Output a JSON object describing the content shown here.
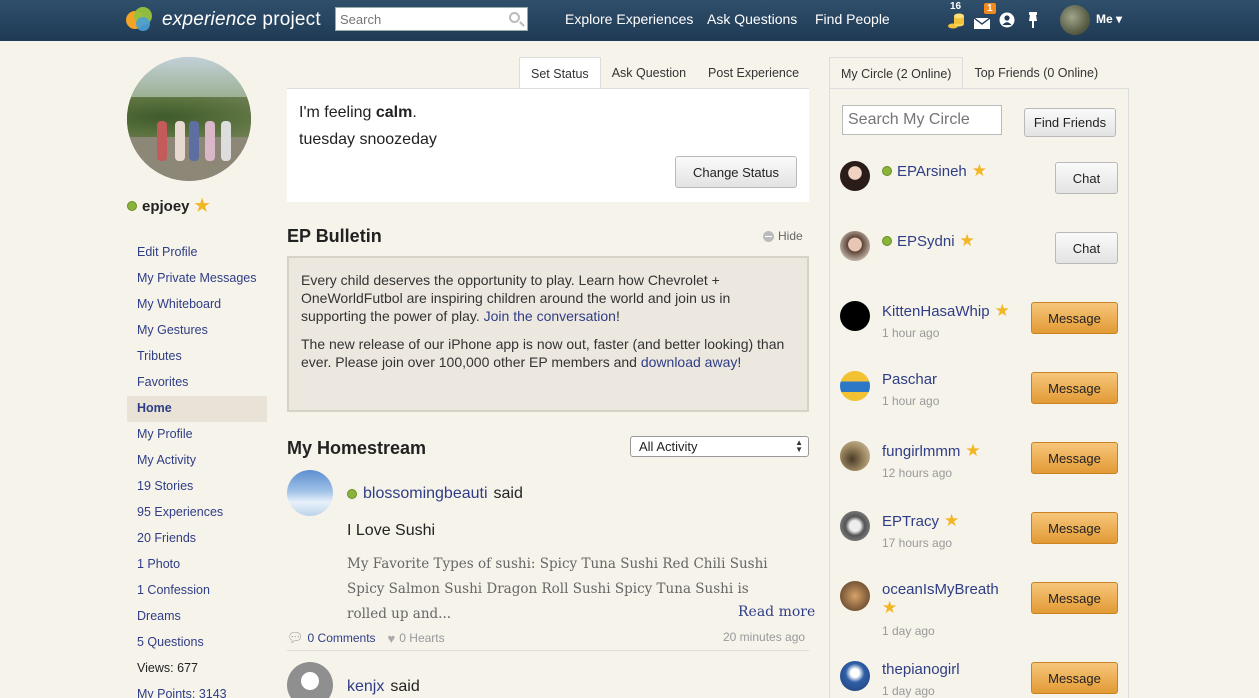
{
  "topbar": {
    "logo_text_italic": "experience",
    "logo_text": " project",
    "search_placeholder": "Search",
    "nav": [
      "Explore Experiences",
      "Ask Questions",
      "Find People"
    ],
    "points_badge": "16",
    "messages_badge": "1",
    "me_label": "Me"
  },
  "profile": {
    "username": "epjoey"
  },
  "leftnav": [
    {
      "label": "Edit Profile"
    },
    {
      "label": "My Private Messages"
    },
    {
      "label": "My Whiteboard"
    },
    {
      "label": "My Gestures"
    },
    {
      "label": "Tributes"
    },
    {
      "label": "Favorites"
    },
    {
      "label": "Home"
    },
    {
      "label": "My Profile"
    },
    {
      "label": "My Activity"
    },
    {
      "label": "19 Stories"
    },
    {
      "label": "95 Experiences"
    },
    {
      "label": "20 Friends"
    },
    {
      "label": "1 Photo"
    },
    {
      "label": "1 Confession"
    },
    {
      "label": "Dreams"
    },
    {
      "label": "5 Questions"
    },
    {
      "label": "Views: 677"
    },
    {
      "label": "My Points: 3143"
    }
  ],
  "status": {
    "tabs": [
      "Set Status",
      "Ask Question",
      "Post Experience"
    ],
    "feeling_prefix": "I'm feeling ",
    "feeling_word": "calm",
    "feeling_suffix": ".",
    "message": "tuesday snoozeday",
    "change_button": "Change Status"
  },
  "bulletin": {
    "title": "EP Bulletin",
    "hide_label": "Hide",
    "p1_text": "Every child deserves the opportunity to play. Learn how Chevrolet + OneWorldFutbol are inspiring children around the world and join us in supporting the power of play. ",
    "p1_link": "Join the conversation",
    "p1_end": "!",
    "p2_text": "The new release of our iPhone app is now out, faster (and better looking) than ever. Please join over 100,000 other EP members and ",
    "p2_link": "download away",
    "p2_end": "!"
  },
  "homestream": {
    "title": "My Homestream",
    "filter_selected": "All Activity",
    "posts": [
      {
        "user": "blossomingbeauti",
        "verb": "said",
        "title": "I Love Sushi",
        "excerpt": "My Favorite Types of sushi: Spicy Tuna Sushi Red Chili Sushi Spicy Salmon Sushi Dragon Roll Sushi Spicy Tuna Sushi is rolled up and...",
        "read_more": "Read more",
        "comments": "0 Comments",
        "hearts": "0 Hearts",
        "time": "20 minutes ago"
      },
      {
        "user": "kenjx",
        "verb": "said"
      }
    ]
  },
  "circle": {
    "tabs": [
      "My Circle (2 Online)",
      "Top Friends (0 Online)"
    ],
    "search_placeholder": "Search My Circle",
    "find_friends": "Find Friends",
    "friends": [
      {
        "name": "EPArsineh",
        "online": true,
        "star": true,
        "time": "",
        "action": "Chat"
      },
      {
        "name": "EPSydni",
        "online": true,
        "star": true,
        "time": "",
        "action": "Chat"
      },
      {
        "name": "KittenHasaWhip",
        "online": false,
        "star": true,
        "time": "1 hour ago",
        "action": "Message"
      },
      {
        "name": "Paschar",
        "online": false,
        "star": false,
        "time": "1 hour ago",
        "action": "Message"
      },
      {
        "name": "fungirlmmm",
        "online": false,
        "star": true,
        "time": "12 hours ago",
        "action": "Message"
      },
      {
        "name": "EPTracy",
        "online": false,
        "star": true,
        "time": "17 hours ago",
        "action": "Message"
      },
      {
        "name": "oceanIsMyBreath",
        "online": false,
        "star": true,
        "time": "1 day ago",
        "action": "Message"
      },
      {
        "name": "thepianogirl",
        "online": false,
        "star": false,
        "time": "1 day ago",
        "action": "Message"
      }
    ]
  }
}
